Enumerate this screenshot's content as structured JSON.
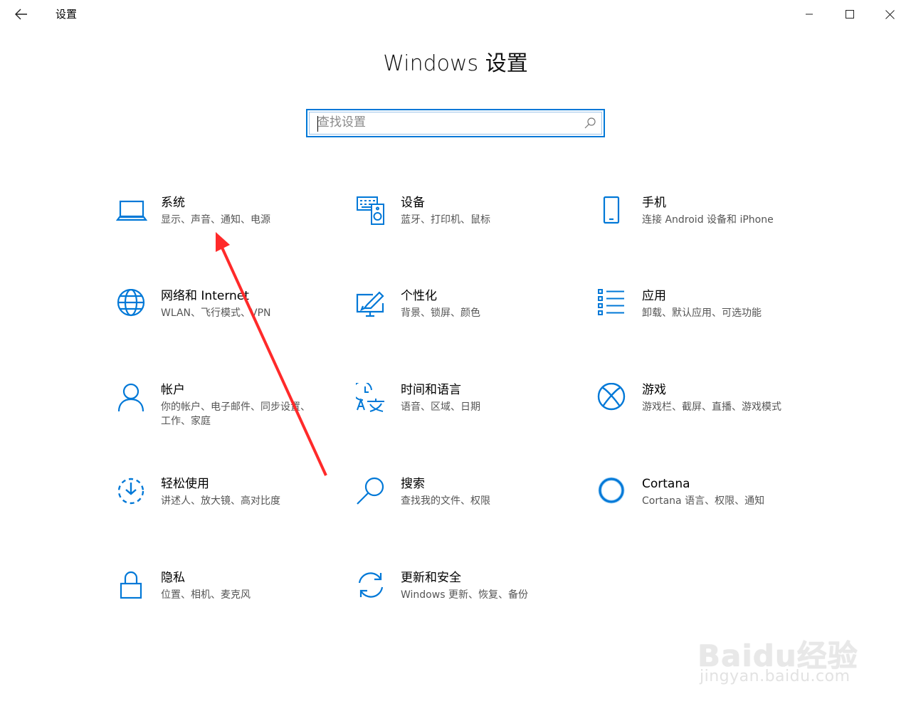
{
  "window": {
    "title": "设置",
    "back_icon": "back-arrow-icon",
    "minimize_icon": "minimize-icon",
    "maximize_icon": "maximize-icon",
    "close_icon": "close-icon"
  },
  "page": {
    "title": "Windows 设置"
  },
  "search": {
    "placeholder": "查找设置",
    "value": "",
    "icon": "search-icon"
  },
  "accent_color": "#0078d7",
  "annotation_color": "#ff2a2a",
  "tiles": [
    {
      "title": "系统",
      "desc": "显示、声音、通知、电源",
      "icon": "laptop-icon"
    },
    {
      "title": "设备",
      "desc": "蓝牙、打印机、鼠标",
      "icon": "devices-icon"
    },
    {
      "title": "手机",
      "desc": "连接 Android 设备和 iPhone",
      "icon": "phone-icon"
    },
    {
      "title": "网络和 Internet",
      "desc": "WLAN、飞行模式、VPN",
      "icon": "globe-icon"
    },
    {
      "title": "个性化",
      "desc": "背景、锁屏、颜色",
      "icon": "personalization-icon"
    },
    {
      "title": "应用",
      "desc": "卸载、默认应用、可选功能",
      "icon": "apps-list-icon"
    },
    {
      "title": "帐户",
      "desc": "你的帐户、电子邮件、同步设置、工作、家庭",
      "icon": "person-icon"
    },
    {
      "title": "时间和语言",
      "desc": "语音、区域、日期",
      "icon": "time-language-icon"
    },
    {
      "title": "游戏",
      "desc": "游戏栏、截屏、直播、游戏模式",
      "icon": "xbox-icon"
    },
    {
      "title": "轻松使用",
      "desc": "讲述人、放大镜、高对比度",
      "icon": "ease-of-access-icon"
    },
    {
      "title": "搜索",
      "desc": "查找我的文件、权限",
      "icon": "magnifier-icon"
    },
    {
      "title": "Cortana",
      "desc": "Cortana 语言、权限、通知",
      "icon": "cortana-icon"
    },
    {
      "title": "隐私",
      "desc": "位置、相机、麦克风",
      "icon": "lock-icon"
    },
    {
      "title": "更新和安全",
      "desc": "Windows 更新、恢复、备份",
      "icon": "update-icon"
    }
  ],
  "watermark": {
    "logo": "Baidu经验",
    "url": "jingyan.baidu.com"
  }
}
